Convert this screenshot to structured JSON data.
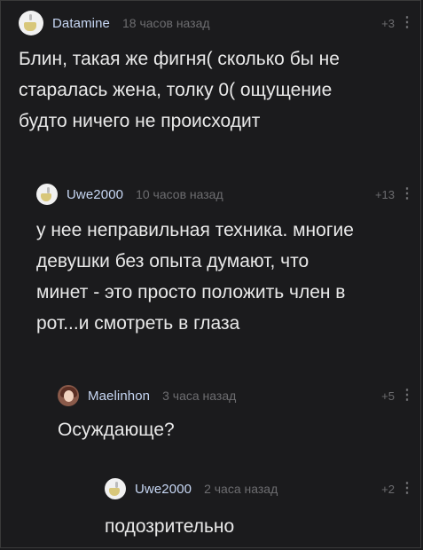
{
  "comments": [
    {
      "username": "Datamine",
      "time": "18 часов назад",
      "score": "+3",
      "more_icon": "vertical-ellipsis",
      "avatar_icon": "mug-avatar-icon",
      "text": "Блин, такая же фигня( сколько бы не\nстаралась жена, толку 0( ощущение\nбудто ничего не происходит"
    },
    {
      "username": "Uwe2000",
      "time": "10 часов назад",
      "score": "+13",
      "more_icon": "vertical-ellipsis",
      "avatar_icon": "mug-avatar-icon",
      "text": "у нее неправильная техника. многие\nдевушки без опыта думают, что\nминет - это просто положить член в\nрот...и смотреть в глаза"
    },
    {
      "username": "Maelinhon",
      "time": "3 часа назад",
      "score": "+5",
      "more_icon": "vertical-ellipsis",
      "avatar_icon": "person-avatar-icon",
      "text": "Осуждающе?"
    },
    {
      "username": "Uwe2000",
      "time": "2 часа назад",
      "score": "+2",
      "more_icon": "vertical-ellipsis",
      "avatar_icon": "mug-avatar-icon",
      "text": "подозрительно"
    }
  ],
  "colors": {
    "background": "#1b1b1d",
    "username": "#c7d7f4",
    "muted": "#6d6d70",
    "text": "#e9e9e9"
  }
}
